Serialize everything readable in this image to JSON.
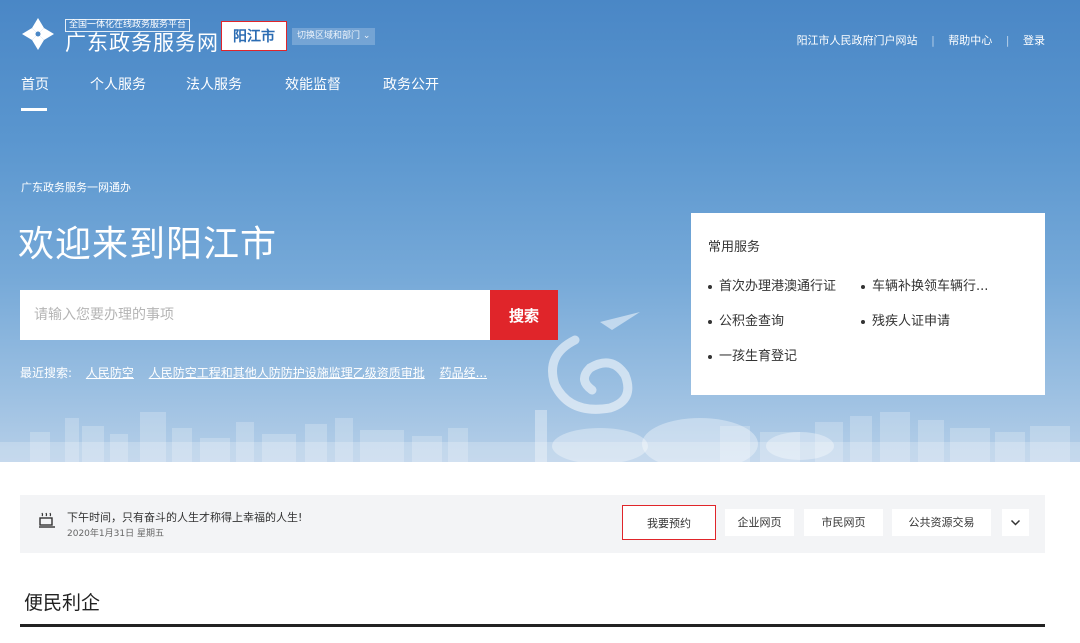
{
  "header": {
    "logo_subtitle": "全国一体化在线政务服务平台",
    "logo_title": "广东政务服务网",
    "city": "阳江市",
    "switch_label": "切换区域和部门",
    "links": [
      "阳江市人民政府门户网站",
      "帮助中心",
      "登录"
    ]
  },
  "nav": {
    "items": [
      "首页",
      "个人服务",
      "法人服务",
      "效能监督",
      "政务公开"
    ],
    "active": "首页"
  },
  "hero": {
    "tagline": "广东政务服务一网通办",
    "welcome": "欢迎来到阳江市",
    "search_placeholder": "请输入您要办理的事项",
    "search_button": "搜索",
    "recent_label": "最近搜索:",
    "recent_items": [
      "人民防空",
      "人民防空工程和其他人防防护设施监理乙级资质审批",
      "药品经..."
    ]
  },
  "services": {
    "title": "常用服务",
    "items": [
      "首次办理港澳通行证",
      "车辆补换领车辆行...",
      "公积金查询",
      "残疾人证申请",
      "一孩生育登记"
    ]
  },
  "notice": {
    "message": "下午时间，只有奋斗的人生才称得上幸福的人生!",
    "date": "2020年1月31日 星期五",
    "buttons": [
      "我要预约",
      "企业网页",
      "市民网页",
      "公共资源交易"
    ]
  },
  "section": {
    "title": "便民利企"
  },
  "colors": {
    "accent_red": "#e0252a",
    "hero_blue": "#4a87c6",
    "city_blue": "#2b6cb3"
  }
}
